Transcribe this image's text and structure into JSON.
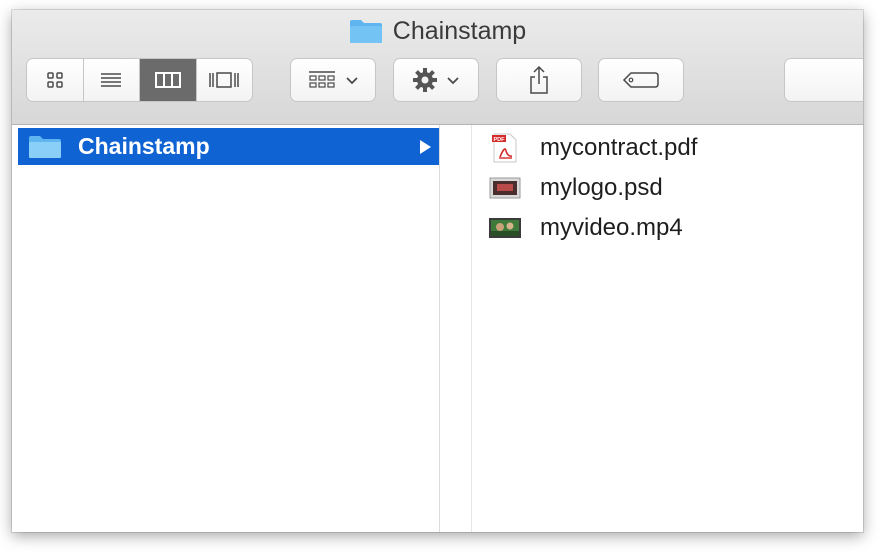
{
  "window": {
    "title": "Chainstamp"
  },
  "toolbar": {
    "view_modes": [
      {
        "name": "icon-view",
        "active": false
      },
      {
        "name": "list-view",
        "active": false
      },
      {
        "name": "column-view",
        "active": true
      },
      {
        "name": "cover-flow-view",
        "active": false
      }
    ],
    "icons": [
      "grid-icon",
      "list-icon",
      "columns-icon",
      "cover-flow-icon",
      "group-icon",
      "gear-icon",
      "share-icon",
      "tag-icon"
    ]
  },
  "columns": {
    "first": {
      "items": [
        {
          "label": "Chainstamp",
          "selected": true,
          "icon": "folder-icon"
        }
      ]
    },
    "second": {
      "items": [
        {
          "label": "mycontract.pdf",
          "icon": "pdf-icon"
        },
        {
          "label": "mylogo.psd",
          "icon": "image-icon"
        },
        {
          "label": "myvideo.mp4",
          "icon": "video-icon"
        }
      ]
    }
  },
  "colors": {
    "selection": "#0f63d3",
    "folder": "#5fb5f0",
    "active_segment": "#6b6b6b"
  }
}
